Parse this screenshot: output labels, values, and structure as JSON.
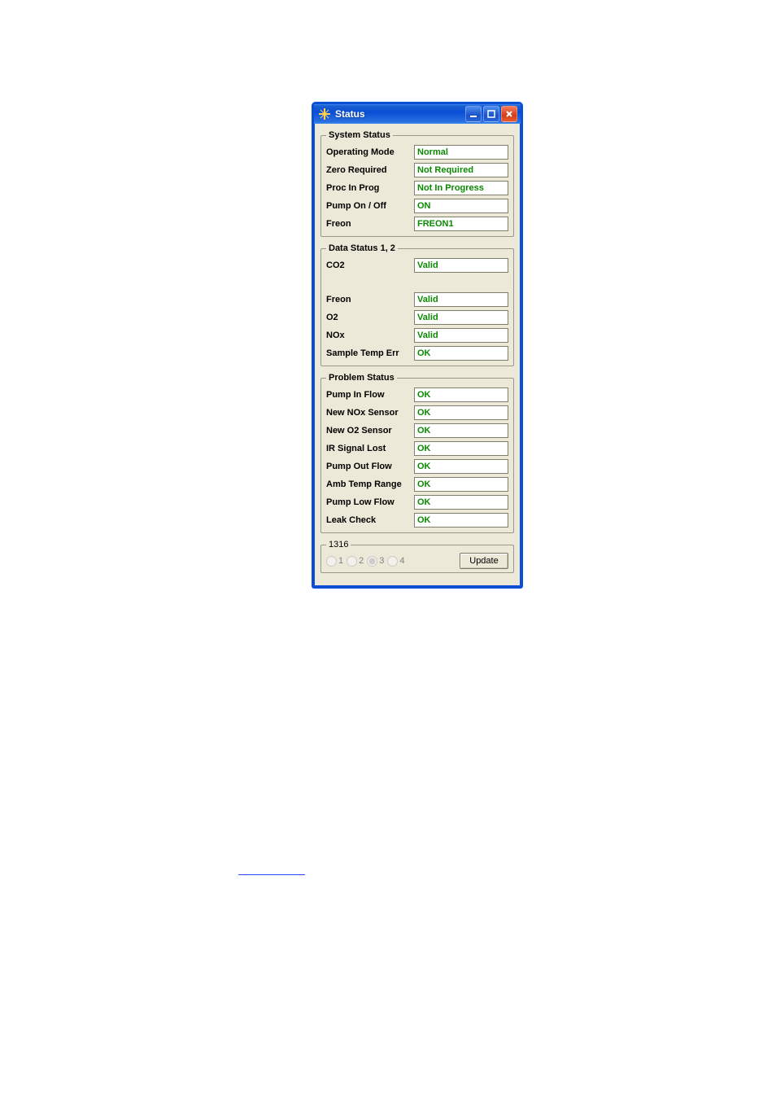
{
  "window": {
    "title": "Status"
  },
  "system_status": {
    "legend": "System Status",
    "rows": [
      {
        "label": "Operating Mode",
        "value": "Normal"
      },
      {
        "label": "Zero Required",
        "value": "Not Required"
      },
      {
        "label": "Proc In Prog",
        "value": "Not In Progress"
      },
      {
        "label": "Pump On / Off",
        "value": "ON"
      },
      {
        "label": "Freon",
        "value": "FREON1"
      }
    ]
  },
  "data_status": {
    "legend": "Data Status 1, 2",
    "rows": [
      {
        "label": "CO2",
        "value": "Valid"
      },
      {
        "label": "",
        "value": ""
      },
      {
        "label": "Freon",
        "value": "Valid"
      },
      {
        "label": "O2",
        "value": "Valid"
      },
      {
        "label": "NOx",
        "value": "Valid"
      },
      {
        "label": "Sample Temp Err",
        "value": "OK"
      }
    ]
  },
  "problem_status": {
    "legend": "Problem Status",
    "rows": [
      {
        "label": "Pump In Flow",
        "value": "OK"
      },
      {
        "label": "New NOx Sensor",
        "value": "OK"
      },
      {
        "label": "New O2 Sensor",
        "value": "OK"
      },
      {
        "label": "IR Signal Lost",
        "value": "OK"
      },
      {
        "label": "Pump Out Flow",
        "value": "OK"
      },
      {
        "label": "Amb Temp Range",
        "value": "OK"
      },
      {
        "label": "Pump Low Flow",
        "value": "OK"
      },
      {
        "label": "Leak Check",
        "value": "OK"
      }
    ]
  },
  "footer": {
    "legend": "1316",
    "options": [
      "1",
      "2",
      "3",
      "4"
    ],
    "selected": "3",
    "update_label": "Update"
  }
}
